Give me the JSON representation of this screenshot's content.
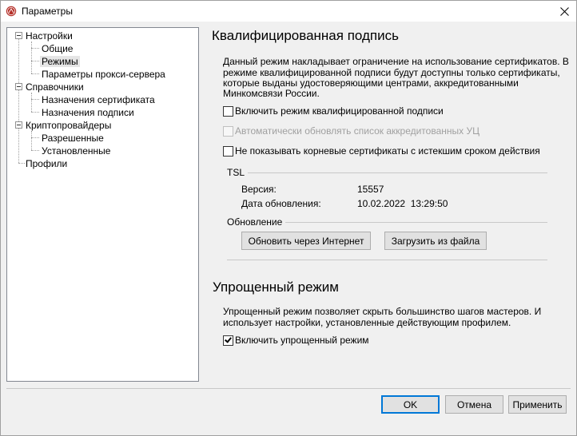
{
  "window": {
    "title": "Параметры"
  },
  "tree": {
    "nastroyki": "Настройки",
    "obshchie": "Общие",
    "rezhimy": "Режимы",
    "proxy": "Параметры прокси-сервера",
    "spravochniki": "Справочники",
    "naznacheniya_sertifikata": "Назначения сертификата",
    "naznacheniya_podpisi": "Назначения подписи",
    "kriptoprovaydery": "Криптопровайдеры",
    "razreshennye": "Разрешенные",
    "ustanovlennye": "Установленные",
    "profili": "Профили"
  },
  "qualified": {
    "heading": "Квалифицированная подпись",
    "desc_line1": "Данный режим накладывает ограничение на использование сертификатов. В",
    "desc_line2": "режиме квалифицированной подписи будут доступны только сертификаты,",
    "desc_line3": "которые выданы удостоверяющими центрами, аккредитованными",
    "desc_line4": "Минкомсвязи России.",
    "cb_enable": {
      "label": "Включить режим квалифицированной подписи",
      "checked": false
    },
    "cb_autoupdate": {
      "label": "Автоматически обновлять список аккредитованных УЦ",
      "checked": false,
      "enabled": false
    },
    "cb_hide_expired": {
      "label": "Не показывать корневые сертификаты с истекшим сроком действия",
      "checked": false
    }
  },
  "tsl": {
    "group_label": "TSL",
    "version_label": "Версия:",
    "version_value": "15557",
    "date_label": "Дата обновления:",
    "date_value": "10.02.2022  13:29:50"
  },
  "update": {
    "group_label": "Обновление",
    "btn_internet": "Обновить через Интернет",
    "btn_file": "Загрузить из файла"
  },
  "simplified": {
    "heading": "Упрощенный режим",
    "desc_line1": "Упрощенный режим позволяет скрыть большинство шагов мастеров. И",
    "desc_line2": "использует настройки, установленные действующим профилем.",
    "cb_enable": {
      "label": "Включить упрощенный режим",
      "checked": true
    }
  },
  "footer": {
    "ok": "OK",
    "cancel": "Отмена",
    "apply": "Применить"
  }
}
